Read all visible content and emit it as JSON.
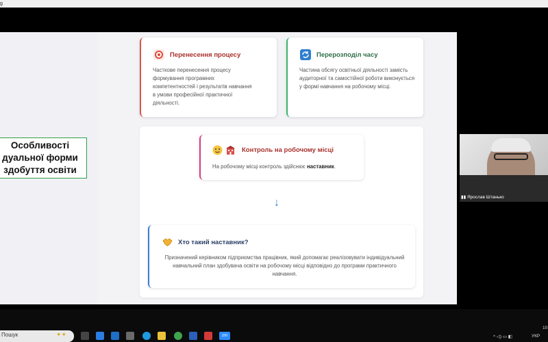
{
  "window": {
    "title_fragment": "g"
  },
  "sidebar_label": "Особливості\nдуальної форми\nздобуття освіти",
  "cards": {
    "transfer": {
      "title": "Перенесення процесу",
      "body": "Часткове перенесення процесу формування програмних компетентностей і результатів навчання в умови професійної практичної діяльності.",
      "accent": "#d9534f"
    },
    "redistribution": {
      "title": "Перерозподіл часу",
      "body": "Частина обсягу освітньої діяльності замість аудиторної та самостійної роботи виконується у формі навчання на робочому місці.",
      "accent": "#3bb56b"
    },
    "control": {
      "title": "Контроль на робочому місці",
      "body_prefix": "На робочому місці контроль здійснює ",
      "body_bold": "наставник",
      "body_suffix": ".",
      "accent": "#d63b79"
    },
    "mentor": {
      "title": "Хто такий наставник?",
      "body": "Призначений керівником підприємства працівник, який допомагає реалізовувати індивідуальний навчальний план здобувача освіти на робочому місці відповідно до програми практичного навчання.",
      "accent": "#3b7bd6"
    }
  },
  "arrow": "↓",
  "video": {
    "participant_name": "Ярослав Штанько"
  },
  "taskbar": {
    "search_placeholder": "Пошук",
    "zoom_label": "zm",
    "lang": "УКР",
    "time_fragment": "10"
  },
  "icons": [
    "target-icon",
    "refresh-icon",
    "face-icon",
    "building-icon",
    "handshake-icon",
    "down-arrow-icon"
  ]
}
